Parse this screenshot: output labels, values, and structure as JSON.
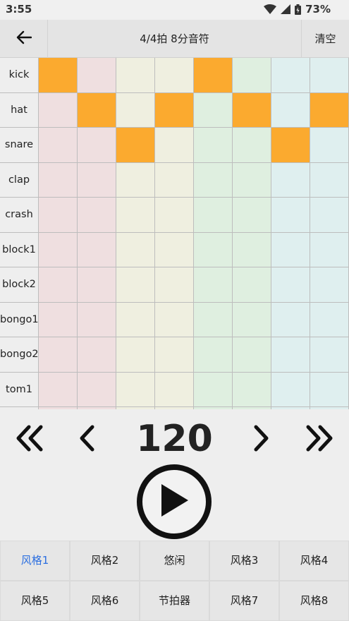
{
  "status": {
    "time": "3:55",
    "battery": "73%"
  },
  "appbar": {
    "title": "4/4拍 8分音符",
    "clear": "清空"
  },
  "grid": {
    "rows": [
      {
        "label": "kick",
        "steps": [
          1,
          0,
          0,
          0,
          1,
          0,
          0,
          0
        ]
      },
      {
        "label": "hat",
        "steps": [
          0,
          1,
          0,
          1,
          0,
          1,
          0,
          1
        ]
      },
      {
        "label": "snare",
        "steps": [
          0,
          0,
          1,
          0,
          0,
          0,
          1,
          0
        ]
      },
      {
        "label": "clap",
        "steps": [
          0,
          0,
          0,
          0,
          0,
          0,
          0,
          0
        ]
      },
      {
        "label": "crash",
        "steps": [
          0,
          0,
          0,
          0,
          0,
          0,
          0,
          0
        ]
      },
      {
        "label": "block1",
        "steps": [
          0,
          0,
          0,
          0,
          0,
          0,
          0,
          0
        ]
      },
      {
        "label": "block2",
        "steps": [
          0,
          0,
          0,
          0,
          0,
          0,
          0,
          0
        ]
      },
      {
        "label": "bongo1",
        "steps": [
          0,
          0,
          0,
          0,
          0,
          0,
          0,
          0
        ]
      },
      {
        "label": "bongo2",
        "steps": [
          0,
          0,
          0,
          0,
          0,
          0,
          0,
          0
        ]
      },
      {
        "label": "tom1",
        "steps": [
          0,
          0,
          0,
          0,
          0,
          0,
          0,
          0
        ]
      },
      {
        "label": "",
        "steps": [
          0,
          0,
          0,
          0,
          0,
          0,
          0,
          0
        ]
      }
    ],
    "colors": {
      "on": "#fbaa2f",
      "group_colors": [
        "#efdfe0",
        "#efefe0",
        "#dfefe0",
        "#dfefef"
      ]
    }
  },
  "controls": {
    "tempo": "120",
    "icons": {
      "fast_back": "double-chevron-left-icon",
      "back": "chevron-left-icon",
      "forward": "chevron-right-icon",
      "fast_forward": "double-chevron-right-icon",
      "play": "play-icon"
    }
  },
  "styles": {
    "buttons": [
      "风格1",
      "风格2",
      "悠闲",
      "风格3",
      "风格4",
      "风格5",
      "风格6",
      "节拍器",
      "风格7",
      "风格8"
    ],
    "active_index": 0,
    "active_color": "#2c6fe0"
  }
}
